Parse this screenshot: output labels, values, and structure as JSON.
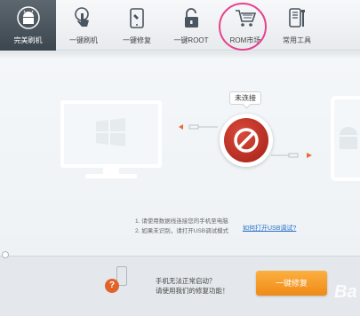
{
  "toolbar": {
    "items": [
      {
        "label": "完美刷机",
        "icon": "android-icon"
      },
      {
        "label": "一键刷机",
        "icon": "touch-icon"
      },
      {
        "label": "一键修复",
        "icon": "phone-wrench-icon"
      },
      {
        "label": "一键ROOT",
        "icon": "unlock-icon"
      },
      {
        "label": "ROM市场",
        "icon": "cart-icon"
      },
      {
        "label": "常用工具",
        "icon": "tools-icon"
      }
    ],
    "active_index": 0
  },
  "device": {
    "status_label": "未连接"
  },
  "hints": {
    "line1": "1. 请使用数据线连接您的手机至电脑",
    "line2": "2. 如果未识别，请打开USB调试模式",
    "link": "如何打开USB调试?"
  },
  "bottom": {
    "line1": "手机无法正常启动？",
    "line2": "请使用我们的修复功能！",
    "help_mark": "?",
    "repair_button": "一键修复"
  },
  "watermark": "Ba",
  "colors": {
    "active_tab": "#3c464e",
    "status_red": "#c1302b",
    "cable_arrow": "#e86b3a",
    "link": "#2a6fc9",
    "repair_button": "#f5a020",
    "highlight_ring": "#e8418e"
  }
}
